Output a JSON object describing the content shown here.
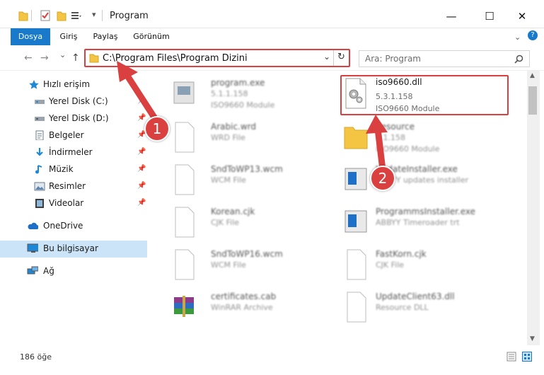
{
  "window": {
    "title": "Program",
    "minimize_glyph": "—",
    "maximize_glyph": "☐",
    "close_glyph": "✕"
  },
  "ribbon": {
    "tabs": [
      "Dosya",
      "Giriş",
      "Paylaş",
      "Görünüm"
    ]
  },
  "nav": {
    "back_glyph": "←",
    "forward_glyph": "→",
    "recent_glyph": "⌄",
    "up_glyph": "↑"
  },
  "address": {
    "path": "C:\\Program Files\\Program Dizini",
    "dropdown_glyph": "⌄",
    "refresh_glyph": "↻"
  },
  "search": {
    "placeholder": "Ara: Program",
    "icon": "search-icon"
  },
  "sidebar": {
    "items": [
      {
        "label": "Hızlı erişim",
        "icon": "star-icon"
      },
      {
        "label": "Yerel Disk (C:)",
        "icon": "drive-icon"
      },
      {
        "label": "Yerel Disk (D:)",
        "icon": "drive-icon"
      },
      {
        "label": "Belgeler",
        "icon": "documents-icon"
      },
      {
        "label": "İndirmeler",
        "icon": "download-icon"
      },
      {
        "label": "Müzik",
        "icon": "music-icon"
      },
      {
        "label": "Resimler",
        "icon": "pictures-icon"
      },
      {
        "label": "Videolar",
        "icon": "video-icon"
      },
      {
        "label": "OneDrive",
        "icon": "cloud-icon"
      },
      {
        "label": "Bu bilgisayar",
        "icon": "computer-icon"
      },
      {
        "label": "Ağ",
        "icon": "network-icon"
      }
    ],
    "pin_glyph": "📌"
  },
  "files": [
    {
      "name": "program.exe",
      "line2": "5.1.1.158",
      "line3": "ISO9660 Module",
      "blurred": true
    },
    {
      "name": "iso9660.dll",
      "line2": "5.3.1.158",
      "line3": "ISO9660 Module",
      "blurred": false
    },
    {
      "name": "Arabic.wrd",
      "line2": "WRD File",
      "line3": "",
      "blurred": true
    },
    {
      "name": "Resource",
      "line2": "5.1.158",
      "line3": "ISO9660 Module",
      "blurred": true
    },
    {
      "name": "SndToWP13.wcm",
      "line2": "WCM File",
      "line3": "",
      "blurred": true
    },
    {
      "name": "UpdateInstaller.exe",
      "line2": "ABBYY updates installer",
      "line3": "",
      "blurred": true
    },
    {
      "name": "Korean.cjk",
      "line2": "CJK File",
      "line3": "",
      "blurred": true
    },
    {
      "name": "ProgrammsInstaller.exe",
      "line2": "ABBYY Timeroader trt",
      "line3": "",
      "blurred": true
    },
    {
      "name": "SndToWP16.wcm",
      "line2": "WCM File",
      "line3": "",
      "blurred": true
    },
    {
      "name": "FastKorn.cjk",
      "line2": "CJK File",
      "line3": "",
      "blurred": true
    },
    {
      "name": "certificates.cab",
      "line2": "WinRAR Archive",
      "line3": "",
      "blurred": true
    },
    {
      "name": "UpdateClient63.dll",
      "line2": "Resource DLL",
      "line3": "",
      "blurred": true
    }
  ],
  "status": {
    "count": "186 öğe"
  },
  "annotations": {
    "badge1": "1",
    "badge2": "2",
    "color": "#d9403f"
  }
}
